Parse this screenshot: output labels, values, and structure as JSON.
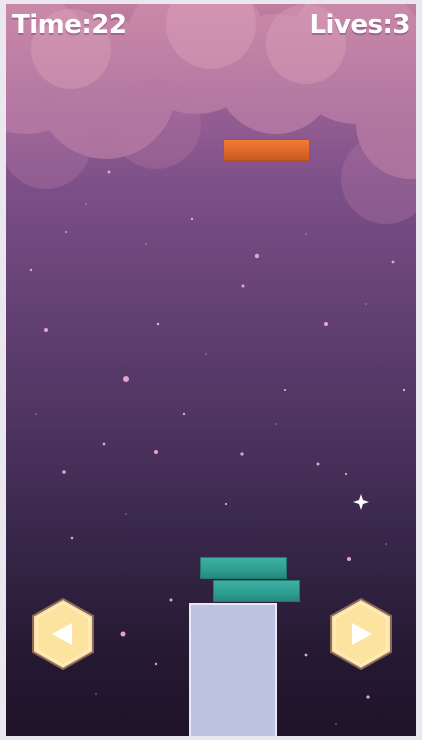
{
  "hud": {
    "time_label": "Time:22",
    "lives_label": "Lives:3"
  },
  "colors": {
    "falling_block": "#e8702c",
    "stacked_block": "#34a598",
    "base_block": "#bfc3e2",
    "button_fill": "#fde3a0"
  },
  "controls": {
    "left_icon": "triangle-left-icon",
    "right_icon": "triangle-right-icon"
  }
}
